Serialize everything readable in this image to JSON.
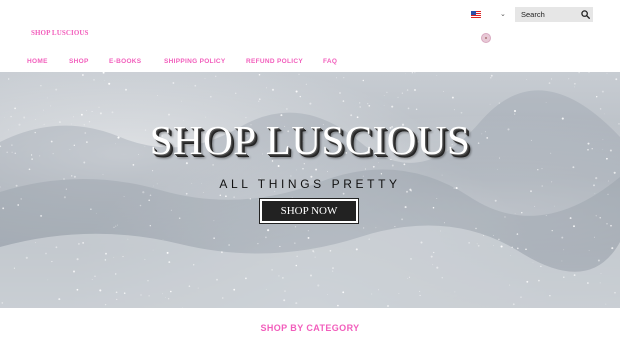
{
  "header": {
    "logo_text": "SHOP LUSCIOUS",
    "currency_icon": "us-flag-icon",
    "search": {
      "placeholder": "Search",
      "icon": "search-icon"
    },
    "account_icon": "account-icon"
  },
  "nav": {
    "items": [
      {
        "label": "HOME"
      },
      {
        "label": "SHOP"
      },
      {
        "label": "E-BOOKS"
      },
      {
        "label": "SHIPPING POLICY"
      },
      {
        "label": "REFUND POLICY"
      },
      {
        "label": "FAQ"
      }
    ]
  },
  "hero": {
    "title": "SHOP LUSCIOUS",
    "subtitle": "ALL THINGS PRETTY",
    "button_label": "SHOP NOW"
  },
  "category_section": {
    "title": "SHOP BY CATEGORY"
  },
  "colors": {
    "accent_pink": "#f25ebc",
    "hero_button_bg": "#222222",
    "search_bg": "#e6e6e6"
  }
}
